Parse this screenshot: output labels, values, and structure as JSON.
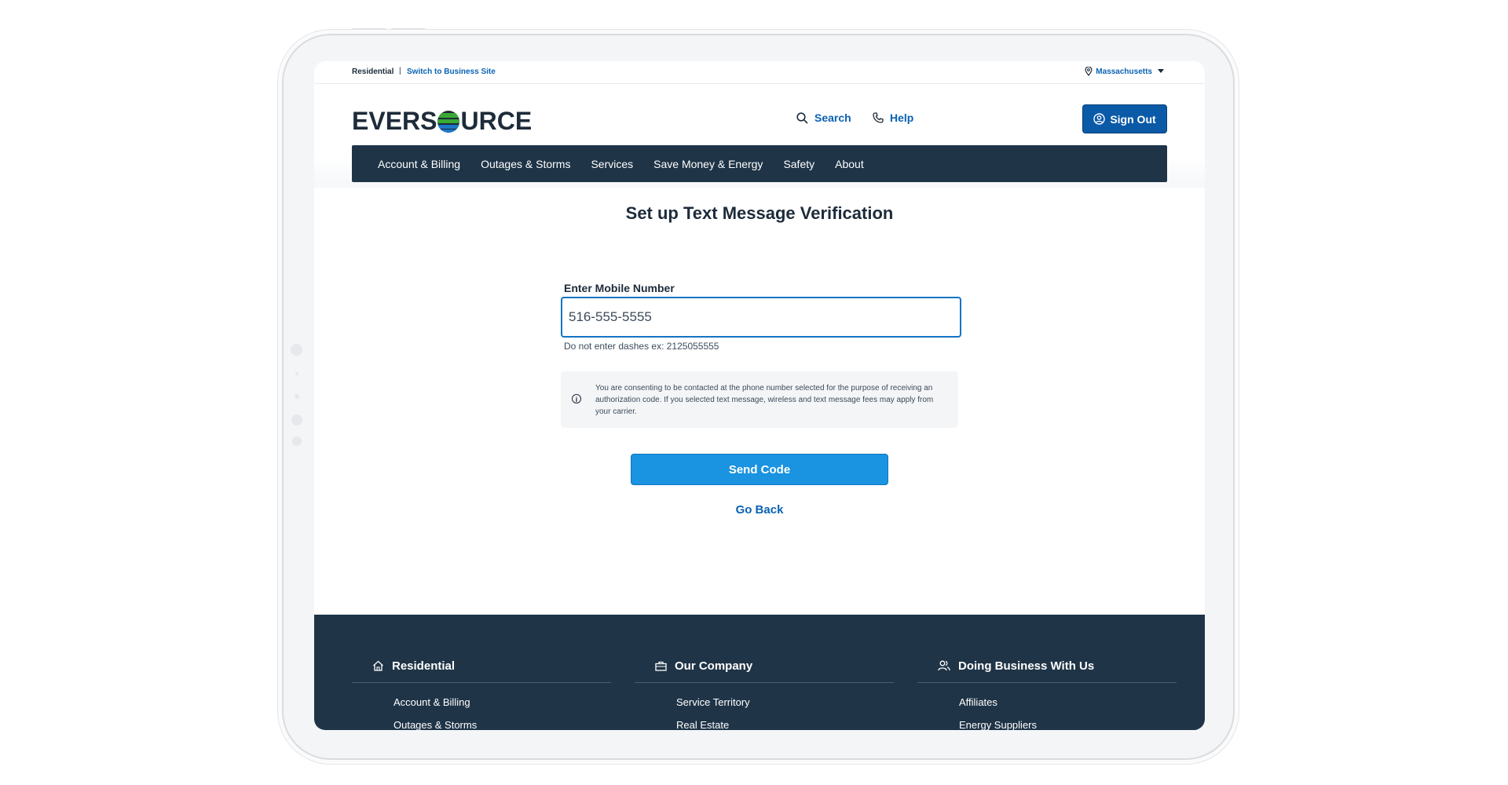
{
  "utility_bar": {
    "segment": "Residential",
    "separator": "|",
    "switch_link": "Switch to Business Site",
    "state": "Massachusetts"
  },
  "header": {
    "logo_text_left": "EVERS",
    "logo_text_right": "URCE",
    "search_label": "Search",
    "help_label": "Help",
    "signout_label": "Sign Out"
  },
  "nav": {
    "items": [
      "Account & Billing",
      "Outages & Storms",
      "Services",
      "Save Money & Energy",
      "Safety",
      "About"
    ]
  },
  "main": {
    "title": "Set up Text Message Verification",
    "mobile_label": "Enter Mobile Number",
    "mobile_value": "516-555-5555",
    "hint": "Do not enter dashes ex: 2125055555",
    "notice": "You are consenting to be contacted at the phone number selected for the purpose of receiving an authorization code. If you selected text message, wireless and text message fees may apply from your carrier.",
    "send_label": "Send Code",
    "back_label": "Go Back"
  },
  "footer": {
    "columns": [
      {
        "heading": "Residential",
        "icon": "home-icon",
        "links": [
          "Account & Billing",
          "Outages & Storms"
        ]
      },
      {
        "heading": "Our Company",
        "icon": "briefcase-icon",
        "links": [
          "Service Territory",
          "Real Estate"
        ]
      },
      {
        "heading": "Doing Business With Us",
        "icon": "people-icon",
        "links": [
          "Affiliates",
          "Energy Suppliers"
        ]
      }
    ]
  },
  "colors": {
    "brand_navy": "#1f3447",
    "link_blue": "#0a62b3",
    "button_blue": "#1a93e0",
    "logo_green": "#3aa935",
    "logo_blue": "#1b78c8"
  }
}
